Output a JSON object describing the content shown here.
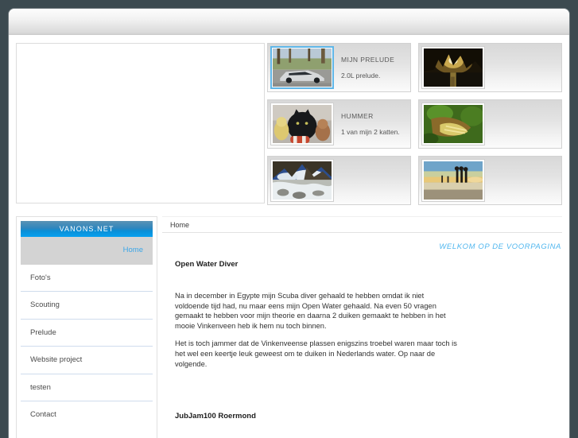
{
  "site": {
    "background_color": "#3c4a50",
    "accent_color": "#069ff0",
    "link_color": "#3aa6e8"
  },
  "gallery": {
    "rows": [
      [
        {
          "id": "mijn-prelude",
          "title": "MIJN PRELUDE",
          "desc": "2.0L prelude.",
          "thumb": "silver-prelude-car-photo",
          "selected": true
        },
        {
          "id": "sunset-water",
          "title": "",
          "desc": "",
          "thumb": "sunset-over-water-photo",
          "selected": false
        }
      ],
      [
        {
          "id": "hummer",
          "title": "HUMMER",
          "desc": "1 van mijn 2 katten.",
          "thumb": "black-cat-with-plush-toys-photo",
          "selected": false
        },
        {
          "id": "green-nature",
          "title": "",
          "desc": "",
          "thumb": "green-foliage-close-up-photo",
          "selected": false
        }
      ],
      [
        {
          "id": "mountain-stream",
          "title": "",
          "desc": "",
          "thumb": "snowy-mountain-stream-photo",
          "selected": false
        },
        {
          "id": "beach-silhouettes",
          "title": "",
          "desc": "",
          "thumb": "beach-silhouettes-at-sunset-photo",
          "selected": false
        }
      ]
    ]
  },
  "sidebar": {
    "brand": "VANONS.NET",
    "items": [
      {
        "label": "Home",
        "active": true
      },
      {
        "label": "Foto's",
        "active": false
      },
      {
        "label": "Scouting",
        "active": false
      },
      {
        "label": "Prelude",
        "active": false
      },
      {
        "label": "Website project",
        "active": false
      },
      {
        "label": "testen",
        "active": false
      },
      {
        "label": "Contact",
        "active": false
      }
    ]
  },
  "content": {
    "breadcrumb": "Home",
    "welcome": "WELKOM OP DE VOORPAGINA",
    "heading1": "Open Water Diver",
    "paragraph1": "Na in december in Egypte mijn Scuba diver gehaald te hebben omdat ik niet voldoende tijd had, nu maar eens mijn Open Water gehaald. Na even 50 vragen gemaakt te hebben voor mijn theorie en daarna 2 duiken gemaakt te hebben in het mooie Vinkenveen heb ik hem nu toch binnen.",
    "paragraph2": "Het is toch jammer dat de Vinkenveense plassen enigszins troebel waren maar toch is het wel een keertje leuk geweest om te duiken in Nederlands water. Op naar de volgende.",
    "heading2": "JubJam100 Roermond"
  }
}
